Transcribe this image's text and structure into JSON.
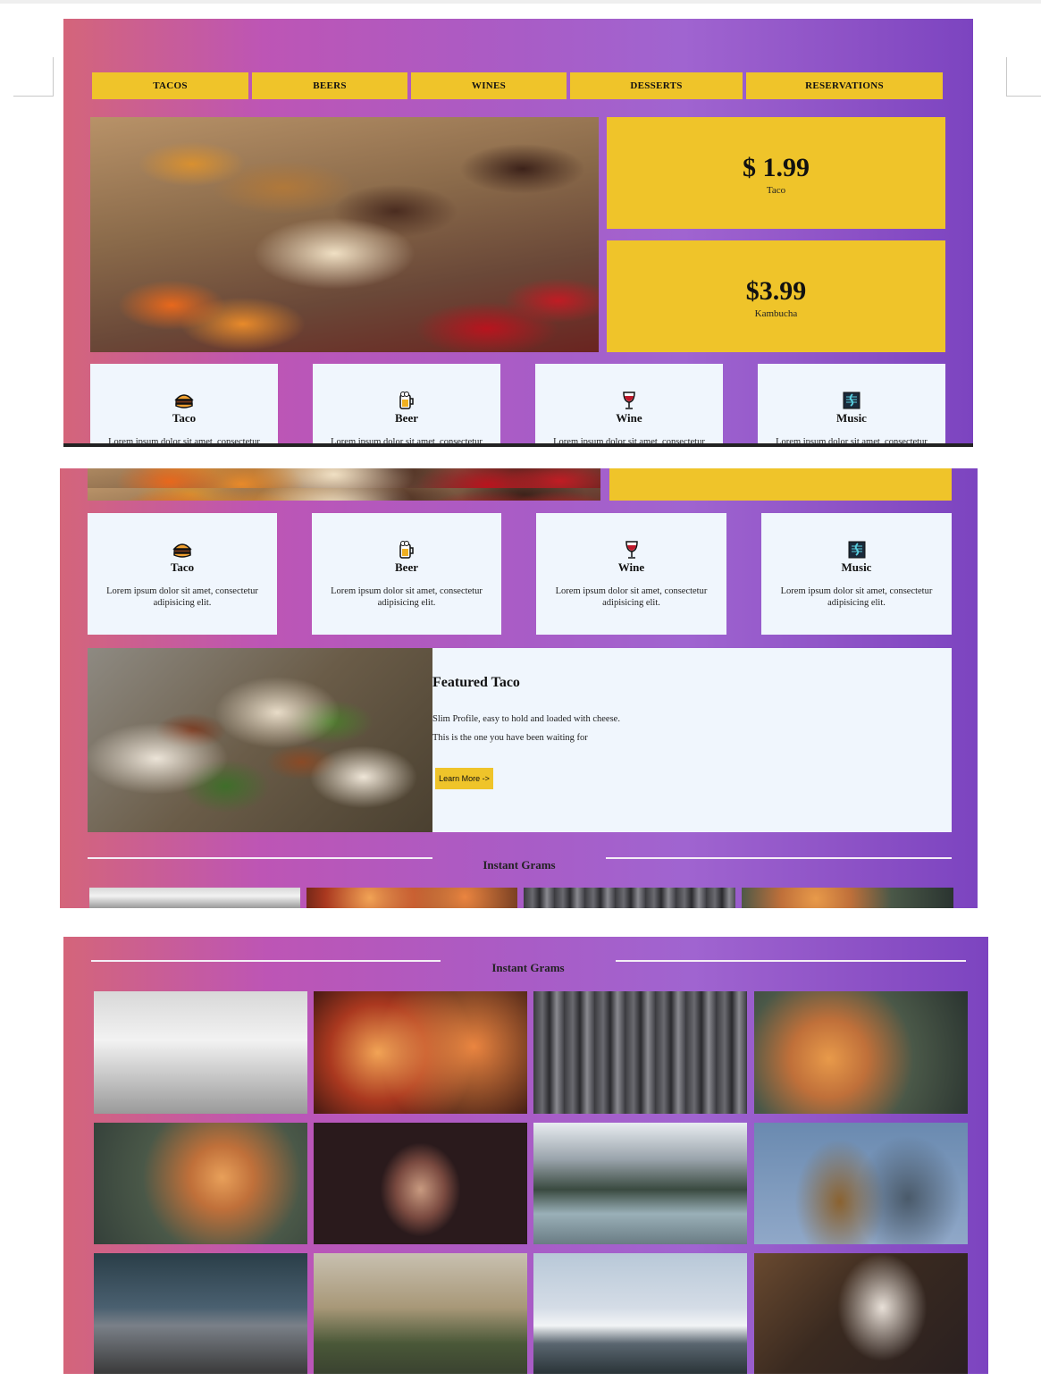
{
  "nav": {
    "items": [
      "TACOS",
      "BEERS",
      "WINES",
      "DESSERTS",
      "RESERVATIONS"
    ]
  },
  "hero": {
    "image": "dessert-case-photo",
    "prices": [
      {
        "price": "$ 1.99",
        "label": "Taco"
      },
      {
        "price": "$3.99",
        "label": "Kambucha"
      }
    ]
  },
  "cards": [
    {
      "icon": "burger-icon",
      "title": "Taco",
      "desc_line1": "Lorem ipsum dolor sit amet, consectetur",
      "desc_line2": "adipisicing elit."
    },
    {
      "icon": "beer-mug-icon",
      "title": "Beer",
      "desc_line1": "Lorem ipsum dolor sit amet, consectetur",
      "desc_line2": "adipisicing elit."
    },
    {
      "icon": "wine-glass-icon",
      "title": "Wine",
      "desc_line1": "Lorem ipsum dolor sit amet, consectetur",
      "desc_line2": "adipisicing elit."
    },
    {
      "icon": "music-icon",
      "title": "Music",
      "desc_line1": "Lorem ipsum dolor sit amet, consectetur",
      "desc_line2": "adipisicing elit."
    }
  ],
  "featured": {
    "title": "Featured Taco",
    "line1": "Slim Profile, easy to hold and loaded with cheese.",
    "line2": "This is the one you have been waiting for",
    "button": "Learn More ->"
  },
  "grams": {
    "title": "Instant Grams"
  },
  "colors": {
    "accent": "#efc42a",
    "card_bg": "#f0f6fd",
    "gradient_start": "#d4657a",
    "gradient_mid": "#a95cc6",
    "gradient_end": "#7c44c0"
  }
}
